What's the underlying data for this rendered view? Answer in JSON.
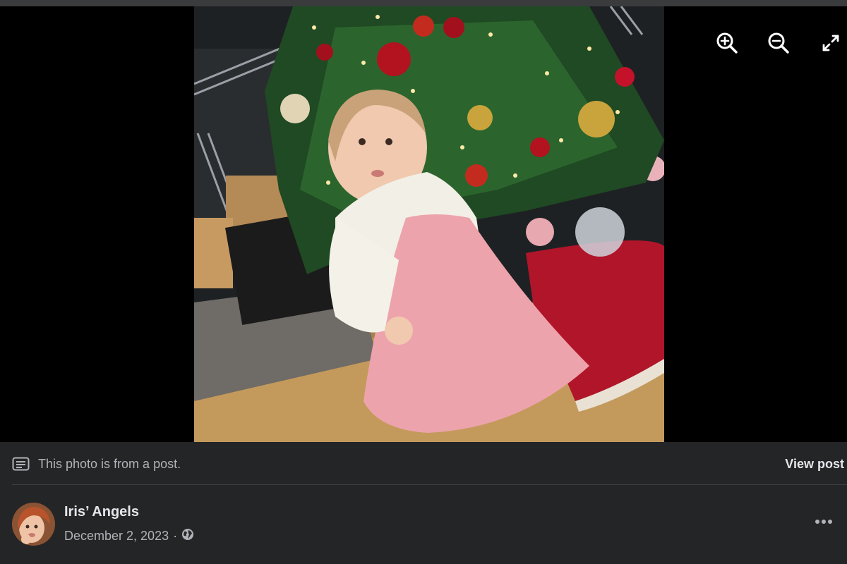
{
  "viewer": {
    "photo_subject": "photo",
    "controls": {
      "zoom_in_icon": "zoom-in-icon",
      "zoom_out_icon": "zoom-out-icon",
      "fullscreen_icon": "fullscreen-icon"
    }
  },
  "notice": {
    "text": "This photo is from a post.",
    "icon": "post-icon",
    "view_post_label": "View post"
  },
  "author": {
    "name": "Iris’ Angels",
    "date": "December 2, 2023",
    "separator": "·",
    "privacy_icon": "globe-icon"
  },
  "colors": {
    "panel_bg": "#242526",
    "primary_text": "#e4e6eb",
    "secondary_text": "#b0b3b8",
    "divider": "#3e4042",
    "viewer_bg": "#000000"
  }
}
